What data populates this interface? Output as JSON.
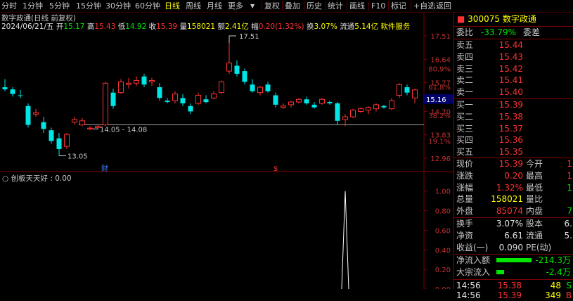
{
  "toolbar": {
    "left_items": [
      "分时",
      "1分钟",
      "5分钟",
      "15分钟",
      "30分钟",
      "60分钟",
      "日线",
      "周线",
      "月线",
      "更多"
    ],
    "active": "日线",
    "right_items": [
      "复权",
      "叠加",
      "历史",
      "统计",
      "画线",
      "F10",
      "标记",
      "+自选",
      "返回"
    ]
  },
  "chart_header": {
    "title": "数字政通(日线 前复权)",
    "date": "2024/06/21/五",
    "open_label": "开",
    "open": "15.17",
    "high_label": "高",
    "high": "15.43",
    "low_label": "低",
    "low": "14.92",
    "close_label": "收",
    "close": "15.39",
    "volume_label": "量",
    "volume": "158021",
    "amount_label": "额",
    "amount": "2.41亿",
    "change_label": "幅",
    "change": "0.20(1.32%)",
    "turnover_label": "换",
    "turnover": "3.07%",
    "float_label": "流通",
    "float": "5.14亿",
    "sector": "软件服务"
  },
  "chart_data": {
    "type": "candlestick",
    "ylim": [
      12.75,
      17.85
    ],
    "y_ticks": [
      "17.51",
      "16.64",
      "15.77",
      "14.70",
      "13.83",
      "12.96"
    ],
    "pct_ticks": [
      {
        "price": 16.3,
        "label": "80.9%"
      },
      {
        "price": 15.62,
        "label": "61.8%"
      },
      {
        "price": 14.55,
        "label": "38.2%"
      },
      {
        "price": 13.6,
        "label": "19.1%"
      }
    ],
    "current_price": "15.16",
    "support_price": 14.2,
    "annotations": {
      "max_label": "17.51",
      "min_label": "13.05",
      "range_label": "14.05 - 14.08",
      "cai_marker": "财",
      "dollar_marker": "$"
    },
    "candles": [
      {
        "o": 15.6,
        "h": 15.9,
        "l": 15.45,
        "c": 15.52
      },
      {
        "o": 15.52,
        "h": 15.6,
        "l": 15.25,
        "c": 15.35
      },
      {
        "o": 15.3,
        "h": 15.5,
        "l": 15.2,
        "c": 15.28
      },
      {
        "o": 14.9,
        "h": 15.0,
        "l": 14.1,
        "c": 14.2
      },
      {
        "o": 14.6,
        "h": 14.8,
        "l": 14.5,
        "c": 14.65
      },
      {
        "o": 14.3,
        "h": 14.5,
        "l": 13.9,
        "c": 14.05
      },
      {
        "o": 14.0,
        "h": 14.1,
        "l": 13.5,
        "c": 13.6
      },
      {
        "o": 13.7,
        "h": 13.9,
        "l": 13.05,
        "c": 13.3
      },
      {
        "o": 13.4,
        "h": 13.9,
        "l": 13.3,
        "c": 13.85
      },
      {
        "o": 14.3,
        "h": 14.5,
        "l": 14.2,
        "c": 14.4
      },
      {
        "o": 14.2,
        "h": 14.45,
        "l": 14.15,
        "c": 14.35
      },
      {
        "o": 14.05,
        "h": 14.15,
        "l": 14.0,
        "c": 14.08
      },
      {
        "o": 14.1,
        "h": 14.2,
        "l": 14.05,
        "c": 14.15
      },
      {
        "o": 14.2,
        "h": 15.8,
        "l": 14.15,
        "c": 15.75
      },
      {
        "o": 15.4,
        "h": 15.55,
        "l": 14.8,
        "c": 14.9
      },
      {
        "o": 15.4,
        "h": 15.9,
        "l": 15.35,
        "c": 15.8
      },
      {
        "o": 15.7,
        "h": 15.95,
        "l": 15.55,
        "c": 15.75
      },
      {
        "o": 15.75,
        "h": 16.0,
        "l": 15.65,
        "c": 15.85
      },
      {
        "o": 16.0,
        "h": 16.1,
        "l": 15.6,
        "c": 15.7
      },
      {
        "o": 15.8,
        "h": 15.95,
        "l": 15.65,
        "c": 15.85
      },
      {
        "o": 15.6,
        "h": 15.75,
        "l": 15.1,
        "c": 15.2
      },
      {
        "o": 15.1,
        "h": 15.2,
        "l": 15.0,
        "c": 15.05
      },
      {
        "o": 15.1,
        "h": 15.45,
        "l": 15.0,
        "c": 15.35
      },
      {
        "o": 15.2,
        "h": 15.35,
        "l": 14.9,
        "c": 15.0
      },
      {
        "o": 14.9,
        "h": 15.0,
        "l": 14.6,
        "c": 14.7
      },
      {
        "o": 15.0,
        "h": 15.4,
        "l": 14.95,
        "c": 15.3
      },
      {
        "o": 15.15,
        "h": 15.3,
        "l": 15.0,
        "c": 15.05
      },
      {
        "o": 15.2,
        "h": 15.45,
        "l": 15.15,
        "c": 15.35
      },
      {
        "o": 15.4,
        "h": 15.85,
        "l": 15.35,
        "c": 15.8
      },
      {
        "o": 16.2,
        "h": 17.51,
        "l": 16.1,
        "c": 16.5
      },
      {
        "o": 16.4,
        "h": 16.6,
        "l": 16.0,
        "c": 16.1
      },
      {
        "o": 16.2,
        "h": 16.3,
        "l": 15.7,
        "c": 15.8
      },
      {
        "o": 15.7,
        "h": 15.9,
        "l": 15.4,
        "c": 15.45
      },
      {
        "o": 15.4,
        "h": 15.65,
        "l": 15.3,
        "c": 15.6
      },
      {
        "o": 15.7,
        "h": 15.8,
        "l": 15.4,
        "c": 15.45
      },
      {
        "o": 15.3,
        "h": 15.4,
        "l": 14.85,
        "c": 14.95
      },
      {
        "o": 14.85,
        "h": 15.0,
        "l": 14.8,
        "c": 14.9
      },
      {
        "o": 14.95,
        "h": 15.1,
        "l": 14.85,
        "c": 15.05
      },
      {
        "o": 15.05,
        "h": 15.2,
        "l": 15.0,
        "c": 15.15
      },
      {
        "o": 15.15,
        "h": 15.25,
        "l": 14.95,
        "c": 15.0
      },
      {
        "o": 14.95,
        "h": 15.05,
        "l": 14.8,
        "c": 14.85
      },
      {
        "o": 15.0,
        "h": 15.2,
        "l": 14.95,
        "c": 15.15
      },
      {
        "o": 15.05,
        "h": 15.1,
        "l": 14.95,
        "c": 15.0
      },
      {
        "o": 15.0,
        "h": 15.05,
        "l": 14.2,
        "c": 14.35
      },
      {
        "o": 14.4,
        "h": 14.6,
        "l": 14.15,
        "c": 14.5
      },
      {
        "o": 14.5,
        "h": 14.8,
        "l": 14.45,
        "c": 14.75
      },
      {
        "o": 14.7,
        "h": 14.85,
        "l": 14.65,
        "c": 14.8
      },
      {
        "o": 14.75,
        "h": 14.9,
        "l": 14.6,
        "c": 14.85
      },
      {
        "o": 14.8,
        "h": 15.0,
        "l": 14.7,
        "c": 14.95
      },
      {
        "o": 14.9,
        "h": 14.95,
        "l": 14.8,
        "c": 14.85
      },
      {
        "o": 14.8,
        "h": 15.2,
        "l": 14.75,
        "c": 15.1
      },
      {
        "o": 15.3,
        "h": 15.75,
        "l": 15.2,
        "c": 15.7
      },
      {
        "o": 15.6,
        "h": 15.7,
        "l": 15.3,
        "c": 15.4
      },
      {
        "o": 15.2,
        "h": 15.55,
        "l": 15.0,
        "c": 15.5
      }
    ]
  },
  "indicator": {
    "name": "创板天天好",
    "value": "0.00",
    "ylim": [
      0,
      1.07
    ],
    "ticks": [
      "1.00",
      "0.80",
      "0.60",
      "0.40",
      "0.20",
      "0.00"
    ],
    "spike_candle_index": 44,
    "spike_value": 1.0
  },
  "quote": {
    "code": "300075",
    "name": "数字政通",
    "ratio_label": "委比",
    "ratio": "-33.79%",
    "diff_label": "委差",
    "diff": "",
    "asks": [
      {
        "label": "卖五",
        "price": "15.44"
      },
      {
        "label": "卖四",
        "price": "15.43"
      },
      {
        "label": "卖三",
        "price": "15.42"
      },
      {
        "label": "卖二",
        "price": "15.41"
      },
      {
        "label": "卖一",
        "price": "15.40"
      }
    ],
    "bids": [
      {
        "label": "买一",
        "price": "15.39"
      },
      {
        "label": "买二",
        "price": "15.38"
      },
      {
        "label": "买三",
        "price": "15.37"
      },
      {
        "label": "买四",
        "price": "15.36"
      },
      {
        "label": "买五",
        "price": "15.35"
      }
    ],
    "stats": [
      {
        "l1": "现价",
        "v1": "15.39",
        "l2": "今开",
        "v2": "1",
        "c1": "red",
        "c2": "red"
      },
      {
        "l1": "涨跌",
        "v1": "0.20",
        "l2": "最高",
        "v2": "1",
        "c1": "red",
        "c2": "red"
      },
      {
        "l1": "涨幅",
        "v1": "1.32%",
        "l2": "最低",
        "v2": "1",
        "c1": "red",
        "c2": "green"
      },
      {
        "l1": "总量",
        "v1": "158021",
        "l2": "量比",
        "v2": "",
        "c1": "yellow",
        "c2": "white"
      },
      {
        "l1": "外盘",
        "v1": "85074",
        "l2": "内盘",
        "v2": "7",
        "c1": "red",
        "c2": "green"
      }
    ],
    "stats2": [
      {
        "l1": "换手",
        "v1": "3.07%",
        "l2": "股本",
        "v2": "6."
      },
      {
        "l1": "净资",
        "v1": "6.61",
        "l2": "流通",
        "v2": "5."
      },
      {
        "l1": "收益(一)",
        "v1": "0.090",
        "l2": "PE(动)",
        "v2": ""
      }
    ],
    "flows": [
      {
        "label": "净流入额",
        "value": "-214.3万",
        "bar": 0.55
      },
      {
        "label": "大宗流入",
        "value": "-2.4万",
        "bar": 0.12
      }
    ],
    "ticks": [
      {
        "time": "14:56",
        "price": "15.38",
        "vol": "48",
        "flag": "S"
      },
      {
        "time": "14:56",
        "price": "15.39",
        "vol": "349",
        "flag": "B"
      }
    ]
  }
}
